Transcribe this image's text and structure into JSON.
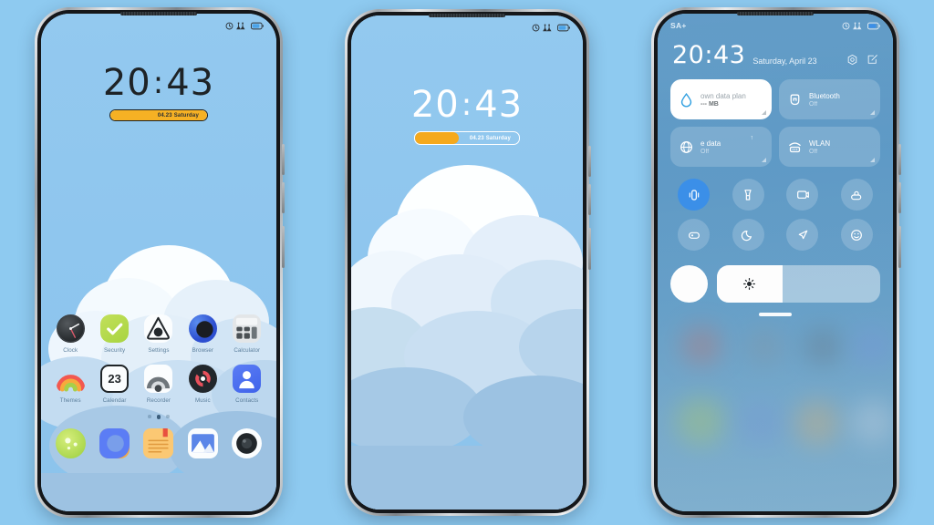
{
  "background_color": "#8ecaf0",
  "theme_accent": "#f6b124",
  "phones": [
    {
      "id": "phone-lock-light",
      "status_bar": {
        "carrier": "",
        "icons": [
          "alarm-icon",
          "signal-icon",
          "battery-icon"
        ]
      },
      "clock": {
        "hours": "20",
        "colon": ":",
        "minutes": "43",
        "date_badge": "04.23 Saturday"
      },
      "home": {
        "rows": [
          [
            {
              "label": "Clock",
              "icon": "clock-icon"
            },
            {
              "label": "Security",
              "icon": "shield-check-icon"
            },
            {
              "label": "Settings",
              "icon": "settings-icon"
            },
            {
              "label": "Browser",
              "icon": "browser-icon"
            },
            {
              "label": "Calculator",
              "icon": "calculator-icon"
            }
          ],
          [
            {
              "label": "Themes",
              "icon": "themes-icon"
            },
            {
              "label": "Calendar",
              "icon": "calendar-icon",
              "day": "23"
            },
            {
              "label": "Recorder",
              "icon": "recorder-icon"
            },
            {
              "label": "Music",
              "icon": "music-icon"
            },
            {
              "label": "Contacts",
              "icon": "contacts-icon"
            }
          ]
        ],
        "page_dots": {
          "count": 3,
          "active_index": 1
        },
        "dock": [
          {
            "label": "",
            "icon": "weather-icon"
          },
          {
            "label": "",
            "icon": "gallery-app-icon"
          },
          {
            "label": "",
            "icon": "notes-icon"
          },
          {
            "label": "",
            "icon": "photos-icon"
          },
          {
            "label": "",
            "icon": "camera-icon"
          }
        ]
      }
    },
    {
      "id": "phone-lock-wallpaper",
      "status_bar": {
        "carrier": "",
        "icons": [
          "alarm-icon",
          "signal-icon",
          "battery-icon"
        ]
      },
      "clock": {
        "hours": "20",
        "colon": ":",
        "minutes": "43",
        "date_badge": "04.23 Saturday"
      }
    },
    {
      "id": "phone-control-center",
      "status_bar": {
        "carrier": "SA+",
        "icons": [
          "alarm-icon",
          "signal-icon",
          "battery-icon"
        ]
      },
      "header": {
        "time": "20:43",
        "date": "Saturday, April 23",
        "icons": [
          "gear-icon",
          "edit-icon"
        ]
      },
      "tiles": [
        {
          "title": "own data plan",
          "subtitle": "--- MB",
          "icon": "data-drop-icon",
          "state": "on"
        },
        {
          "title": "Bluetooth",
          "subtitle": "Off",
          "icon": "bluetooth-icon",
          "state": "off"
        },
        {
          "title": "e data",
          "subtitle": "Off",
          "icon": "mobile-data-icon",
          "state": "off",
          "extra": "↑"
        },
        {
          "title": "WLAN",
          "subtitle": "Off",
          "icon": "wlan-icon",
          "state": "off"
        }
      ],
      "toggles": [
        {
          "name": "vibrate-icon",
          "active": true
        },
        {
          "name": "flashlight-icon",
          "active": false
        },
        {
          "name": "screenshot-icon",
          "active": false
        },
        {
          "name": "lock-rotation-icon",
          "active": false
        },
        {
          "name": "cast-icon",
          "active": false
        },
        {
          "name": "dark-mode-icon",
          "active": false
        },
        {
          "name": "airplane-icon",
          "active": false
        },
        {
          "name": "do-not-disturb-icon",
          "active": false
        }
      ],
      "brightness": {
        "auto_label": "",
        "level_percent": 40,
        "icon": "brightness-icon"
      },
      "drag_handle": "drag-handle"
    }
  ]
}
